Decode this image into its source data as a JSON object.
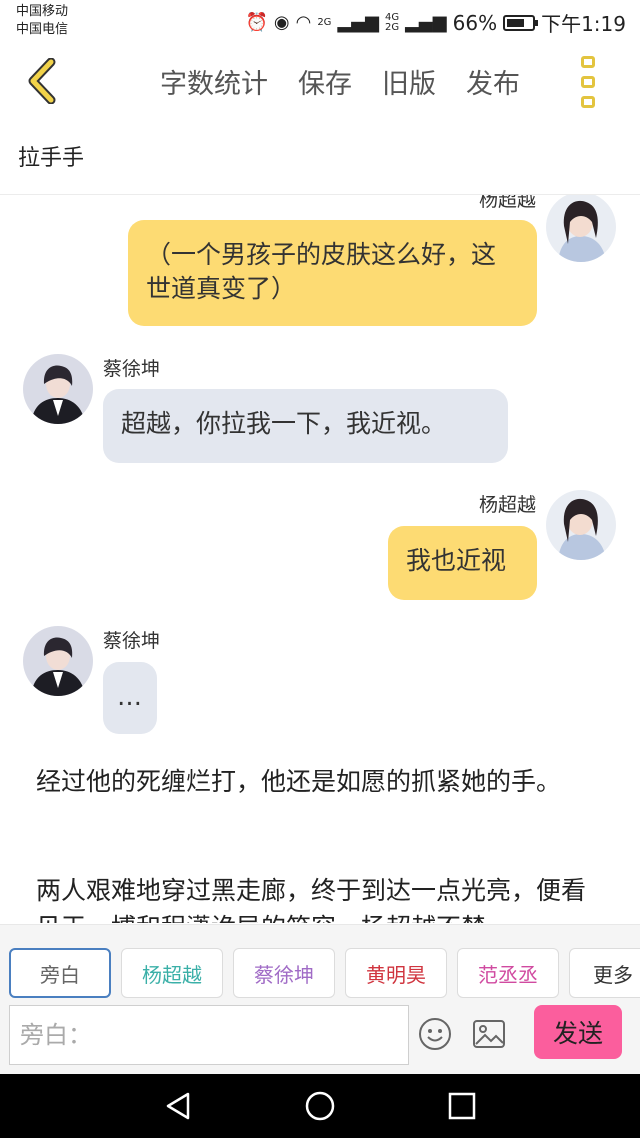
{
  "status_bar": {
    "carrier_1": "中国移动",
    "carrier_2": "中国电信",
    "net_1": "2G",
    "net_2": "4G",
    "net_3": "2G",
    "battery": "66%",
    "time": "下午1:19"
  },
  "toolbar": {
    "word_count": "字数统计",
    "save": "保存",
    "old_version": "旧版",
    "publish": "发布"
  },
  "story_title": "拉手手",
  "messages": [
    {
      "side": "right",
      "name": "杨超越",
      "text": "（一个男孩子的皮肤这么好，这世道真变了）"
    },
    {
      "side": "left",
      "name": "蔡徐坤",
      "text": "超越，你拉我一下，我近视。"
    },
    {
      "side": "right",
      "name": "杨超越",
      "text": "我也近视"
    },
    {
      "side": "left",
      "name": "蔡徐坤",
      "text": "…"
    }
  ],
  "narration": [
    "经过他的死缠烂打，他还是如愿的抓紧她的手。",
    "两人艰难地穿过黑走廊，终于到达一点光亮，便看见王一博和程潇诡异的笑容，杨超越不禁"
  ],
  "roles": [
    {
      "label": "旁白",
      "color": "#666666"
    },
    {
      "label": "杨超越",
      "color": "#3bb0a8"
    },
    {
      "label": "蔡徐坤",
      "color": "#a06bc6"
    },
    {
      "label": "黄明昊",
      "color": "#d0353f"
    },
    {
      "label": "范丞丞",
      "color": "#d04aa0"
    },
    {
      "label": "更多",
      "color": "#333333"
    }
  ],
  "input": {
    "placeholder": "旁白：",
    "value": ""
  },
  "send_label": "发送",
  "colors": {
    "accent": "#e3c43f",
    "right_bubble": "#fddb73",
    "left_bubble": "#e3e7ef",
    "send": "#fb5e9d"
  }
}
